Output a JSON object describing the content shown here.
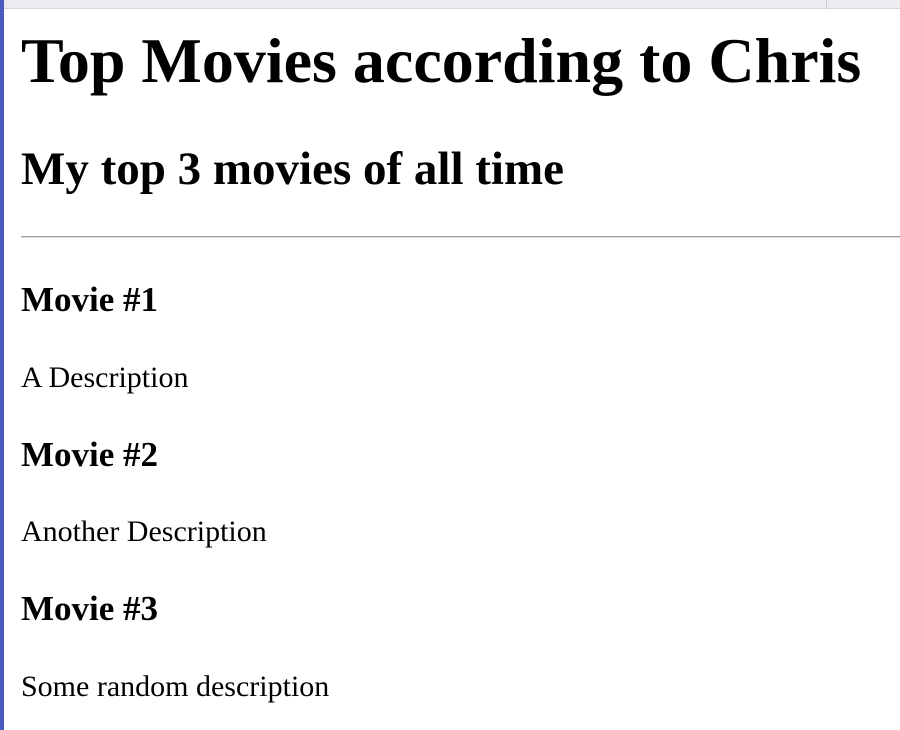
{
  "page": {
    "title": "Top Movies according to Chris",
    "subtitle": "My top 3 movies of all time"
  },
  "movies": [
    {
      "title": "Movie #1",
      "description": "A Description"
    },
    {
      "title": "Movie #2",
      "description": "Another Description"
    },
    {
      "title": "Movie #3",
      "description": "Some random description"
    }
  ],
  "colors": {
    "accent": "#4a5cc4",
    "text": "#000000",
    "background": "#ffffff"
  }
}
